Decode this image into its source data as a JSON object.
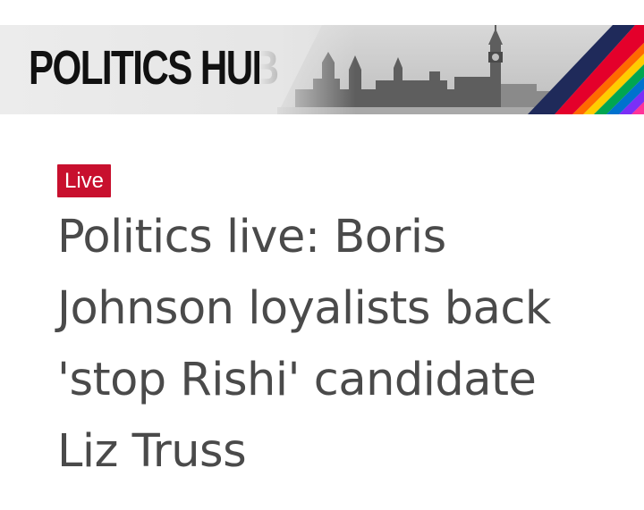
{
  "banner": {
    "title": "POLITICS HUB",
    "image_icon": "westminster-skyline-icon",
    "stripe_colors": [
      "#e4002b",
      "#ff6a00",
      "#ffcc00",
      "#00a651",
      "#0072ce",
      "#7b2ff7",
      "#ff3399"
    ]
  },
  "article": {
    "badge_label": "Live",
    "badge_color": "#c8102e",
    "headline": "Politics live: Boris Johnson loyalists back 'stop Rishi' candidate Liz Truss"
  }
}
